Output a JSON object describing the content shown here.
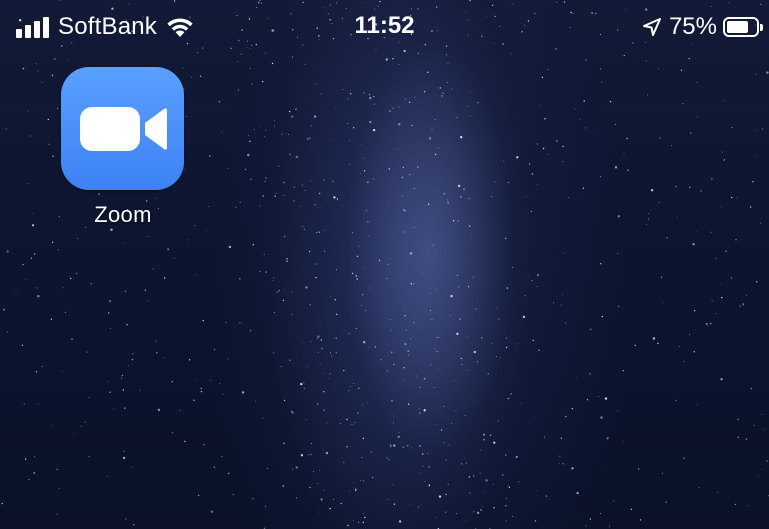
{
  "status_bar": {
    "carrier": "SoftBank",
    "time": "11:52",
    "battery_percent": "75%",
    "battery_level": 0.75,
    "signal_icon": "signal-bars-icon",
    "wifi_icon": "wifi-icon",
    "location_icon": "location-arrow-icon",
    "battery_icon": "battery-icon"
  },
  "home_screen": {
    "apps": [
      {
        "label": "Zoom",
        "icon": "zoom-camera-icon",
        "color": "#3d82f5"
      }
    ],
    "wallpaper": "night-sky-milky-way"
  }
}
